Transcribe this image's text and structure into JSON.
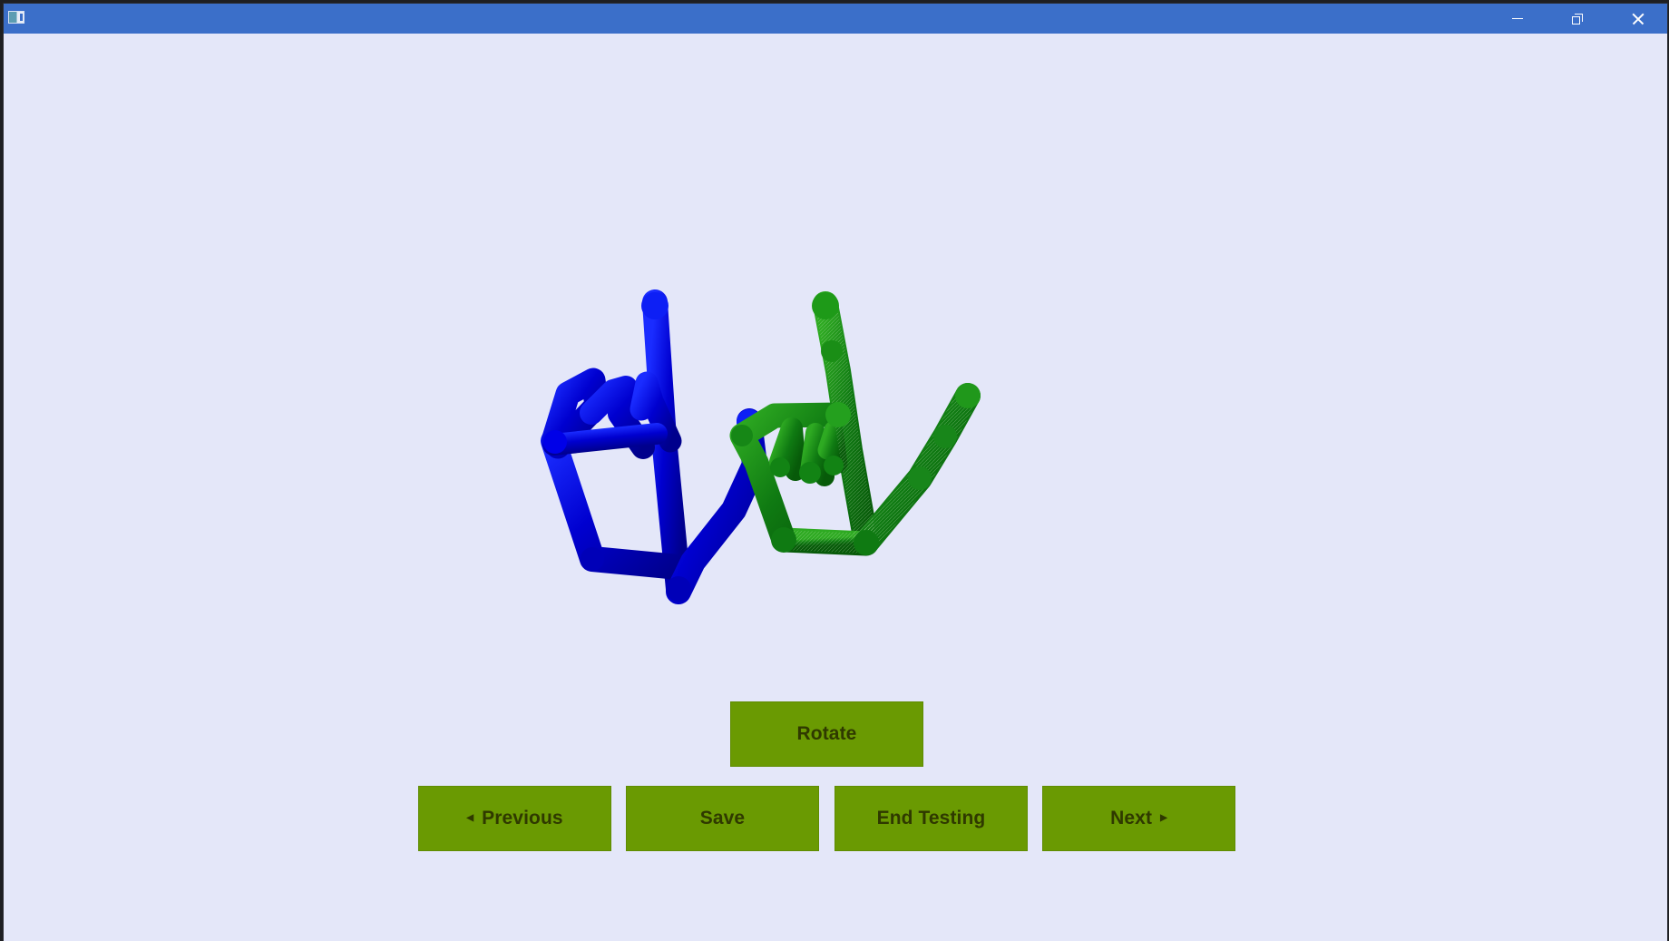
{
  "window": {
    "title": "",
    "accent": "#3b6fc9",
    "background": "#e4e7f9"
  },
  "window_controls": {
    "minimize_icon": "minimize-icon",
    "restore_icon": "restore-icon",
    "close_icon": "close-icon"
  },
  "hand_view": {
    "left_hand": {
      "color": "#0000cc",
      "pose": "hand-skeleton"
    },
    "right_hand": {
      "color": "#0f7a12",
      "pose": "hand-skeleton"
    }
  },
  "buttons": {
    "rotate": {
      "label": "Rotate"
    },
    "previous": {
      "label": "Previous",
      "icon": "left-arrow-icon"
    },
    "save": {
      "label": "Save"
    },
    "end_testing": {
      "label": "End Testing"
    },
    "next": {
      "label": "Next",
      "icon": "right-arrow-icon"
    }
  },
  "button_color": "#6a9a02"
}
